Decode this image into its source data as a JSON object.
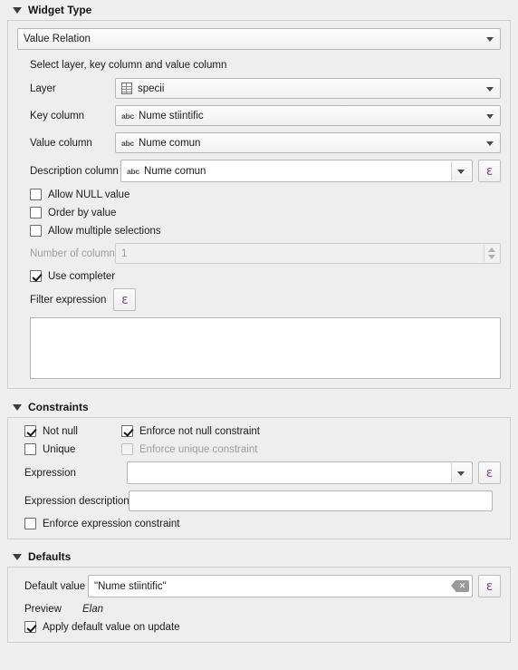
{
  "widget_type": {
    "header": "Widget Type",
    "type_combo": {
      "value": "Value Relation"
    },
    "hint": "Select layer, key column and value column",
    "layer": {
      "label": "Layer",
      "value": "specii",
      "icon": "table-icon"
    },
    "key_column": {
      "label": "Key column",
      "value": "Nume stiintific",
      "type_icon": "abc"
    },
    "value_column": {
      "label": "Value column",
      "value": "Nume comun",
      "type_icon": "abc"
    },
    "description_column": {
      "label": "Description column",
      "value": "Nume comun",
      "type_icon": "abc"
    },
    "allow_null": {
      "label": "Allow NULL value",
      "checked": false
    },
    "order_by_value": {
      "label": "Order by value",
      "checked": false
    },
    "allow_multiple": {
      "label": "Allow multiple selections",
      "checked": false
    },
    "number_of_columns": {
      "label": "Number of columns",
      "value": "1",
      "disabled": true
    },
    "use_completer": {
      "label": "Use completer",
      "checked": true
    },
    "filter_expression": {
      "label": "Filter expression",
      "value": ""
    }
  },
  "constraints": {
    "header": "Constraints",
    "not_null": {
      "label": "Not null",
      "checked": true
    },
    "enforce_not_null": {
      "label": "Enforce not null constraint",
      "checked": true
    },
    "unique": {
      "label": "Unique",
      "checked": false
    },
    "enforce_unique": {
      "label": "Enforce unique constraint",
      "checked": false,
      "disabled": true
    },
    "expression": {
      "label": "Expression",
      "value": ""
    },
    "expression_description": {
      "label": "Expression description",
      "value": ""
    },
    "enforce_expression": {
      "label": "Enforce expression constraint",
      "checked": false
    }
  },
  "defaults": {
    "header": "Defaults",
    "default_value": {
      "label": "Default value",
      "value": "\"Nume stiintific\""
    },
    "preview": {
      "label": "Preview",
      "value": "Elan"
    },
    "apply_on_update": {
      "label": "Apply default value on update",
      "checked": true
    }
  },
  "icons": {
    "expression": "ε",
    "clear": "✕"
  },
  "colors": {
    "expression_purple": "#7d4f86",
    "background": "#efefef",
    "panel": "#eeeeee"
  }
}
